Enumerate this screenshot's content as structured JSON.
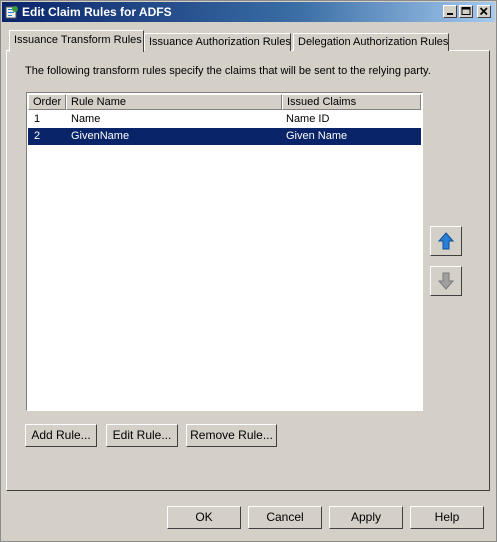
{
  "window": {
    "title": "Edit Claim Rules for ADFS"
  },
  "tabs": [
    {
      "label": "Issuance Transform Rules",
      "active": true
    },
    {
      "label": "Issuance Authorization Rules",
      "active": false
    },
    {
      "label": "Delegation Authorization Rules",
      "active": false
    }
  ],
  "panel": {
    "description": "The following transform rules specify the claims that will be sent to the relying party."
  },
  "rules_table": {
    "columns": [
      "Order",
      "Rule Name",
      "Issued Claims"
    ],
    "rows": [
      {
        "order": "1",
        "rule_name": "Name",
        "issued_claims": "Name ID",
        "selected": false
      },
      {
        "order": "2",
        "rule_name": "GivenName",
        "issued_claims": "Given Name",
        "selected": true
      }
    ]
  },
  "side_buttons": {
    "move_up_icon": "arrow-up-icon",
    "move_down_icon": "arrow-down-icon"
  },
  "rule_buttons": {
    "add": "Add Rule...",
    "edit": "Edit Rule...",
    "remove": "Remove Rule..."
  },
  "dialog_buttons": {
    "ok": "OK",
    "cancel": "Cancel",
    "apply": "Apply",
    "help": "Help"
  },
  "colors": {
    "selection": "#0a246a",
    "dialog_face": "#d4d0c8",
    "arrow_up": "#2a7fd4",
    "arrow_disabled": "#a0a0a0"
  }
}
